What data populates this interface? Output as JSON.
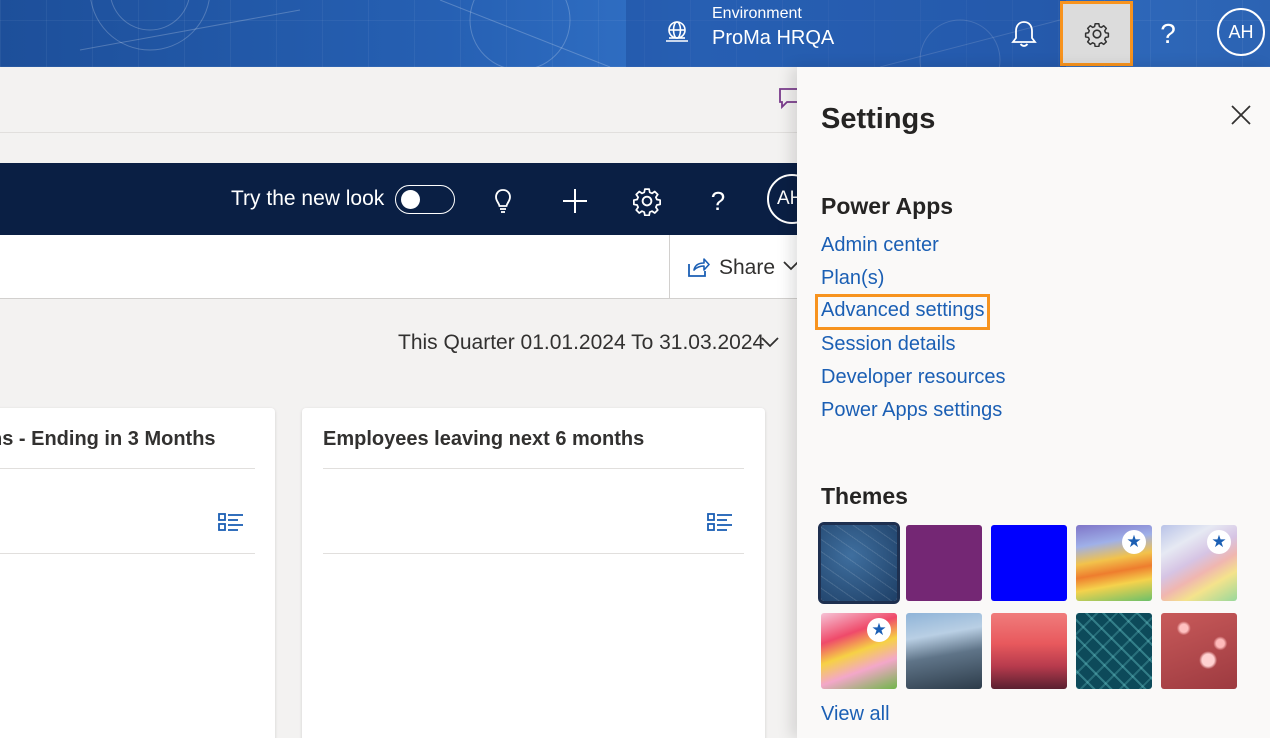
{
  "header": {
    "environment_label": "Environment",
    "environment_value": "ProMa HRQA",
    "help_glyph": "?",
    "avatar_initials": "AH",
    "icons": [
      "globe-icon",
      "bell-icon",
      "gear-icon",
      "help-icon"
    ]
  },
  "app": {
    "try_new_look_label": "Try the new look",
    "toggle_on": false,
    "help_glyph": "?",
    "avatar_initials": "AH",
    "share_label": "Share",
    "date_filter": "This Quarter 01.01.2024 To 31.03.2024",
    "cards": [
      {
        "title": "ns - Ending in 3 Months"
      },
      {
        "title": "Employees leaving next 6 months"
      }
    ]
  },
  "settings": {
    "title": "Settings",
    "power_apps_title": "Power Apps",
    "links": [
      "Admin center",
      "Plan(s)",
      "Advanced settings",
      "Session details",
      "Developer resources",
      "Power Apps settings"
    ],
    "highlighted_link": "Advanced settings",
    "themes_title": "Themes",
    "themes": [
      {
        "name": "theme-blueprint",
        "selected": true,
        "featured": false
      },
      {
        "name": "theme-purple",
        "selected": false,
        "featured": false
      },
      {
        "name": "theme-blue",
        "selected": false,
        "featured": false
      },
      {
        "name": "theme-rainbow",
        "selected": false,
        "featured": true
      },
      {
        "name": "theme-pastel-ribbons",
        "selected": false,
        "featured": true
      },
      {
        "name": "theme-cartoon",
        "selected": false,
        "featured": true
      },
      {
        "name": "theme-mountains",
        "selected": false,
        "featured": false
      },
      {
        "name": "theme-sunset-palms",
        "selected": false,
        "featured": false
      },
      {
        "name": "theme-circuit",
        "selected": false,
        "featured": false
      },
      {
        "name": "theme-bokeh",
        "selected": false,
        "featured": false
      }
    ],
    "view_all_label": "View all"
  },
  "colors": {
    "link": "#1b5fb4",
    "highlight": "#f7931e",
    "nav_dark": "#0a1f44",
    "header_blue": "#2660b3"
  }
}
